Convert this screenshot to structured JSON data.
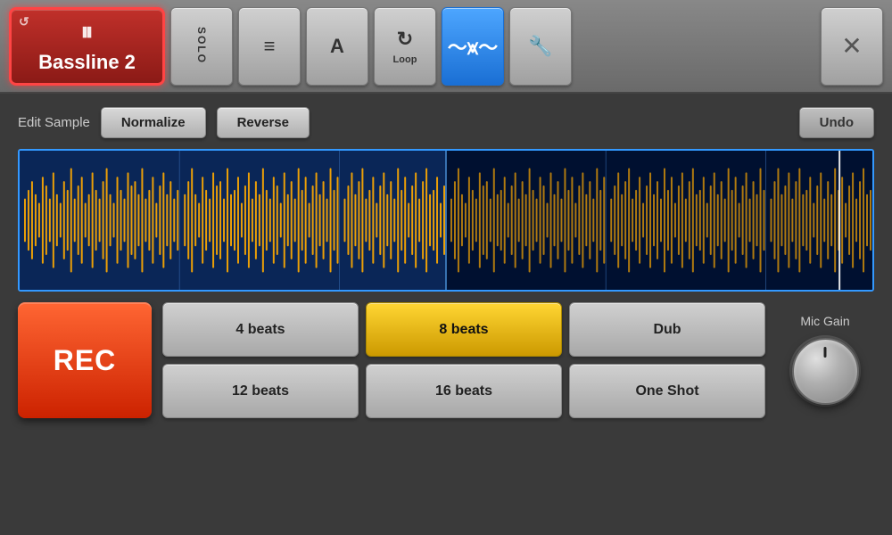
{
  "toolbar": {
    "bassline_label": "Bassline 2",
    "solo_label": "SOLO",
    "lines_icon": "≡",
    "a_label": "A",
    "loop_label": "Loop",
    "wave_label": "",
    "wrench_label": "🔧",
    "close_label": "✕"
  },
  "edit_sample": {
    "label": "Edit Sample",
    "normalize_label": "Normalize",
    "reverse_label": "Reverse",
    "undo_label": "Undo"
  },
  "controls": {
    "rec_label": "REC",
    "beats": [
      {
        "label": "4 beats",
        "active": false
      },
      {
        "label": "8 beats",
        "active": true
      },
      {
        "label": "Dub",
        "active": false
      },
      {
        "label": "12 beats",
        "active": false
      },
      {
        "label": "16 beats",
        "active": false
      },
      {
        "label": "One Shot",
        "active": false
      }
    ],
    "mic_gain_label": "Mic Gain"
  }
}
